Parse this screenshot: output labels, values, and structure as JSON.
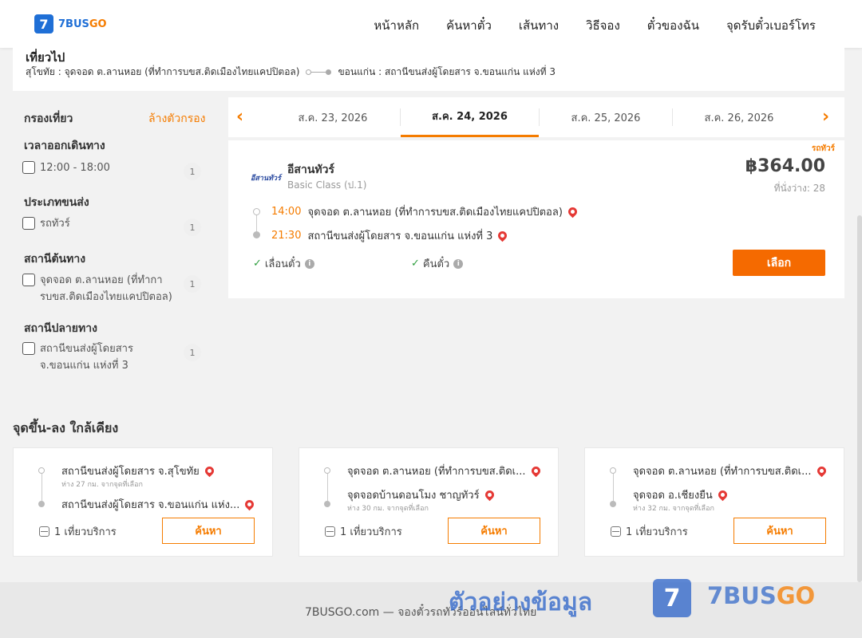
{
  "header": {
    "logo_mark": "7",
    "logo_text_a": "7BUS",
    "logo_text_b": "GO",
    "nav": [
      "หน้าหลัก",
      "ค้นหาตั๋ว",
      "เส้นทาง",
      "วิธีจอง",
      "ตั๋วของฉัน",
      "จุดรับตั๋วเบอร์โทร"
    ]
  },
  "trip": {
    "title": "เที่ยวไป",
    "from": "สุโขทัย : จุดจอด ต.ลานหอย (ที่ทำการบขส.ติดเมืองไทยแคปปิตอล)",
    "to": "ขอนแก่น : สถานีขนส่งผู้โดยสาร จ.ขอนแก่น แห่งที่ 3"
  },
  "filter": {
    "title": "กรองเที่ยว",
    "clear": "ล้างตัวกรอง",
    "sections": [
      {
        "label": "เวลาออกเดินทาง",
        "option": "12:00 - 18:00",
        "count": "1"
      },
      {
        "label": "ประเภทขนส่ง",
        "option": "รถทัวร์",
        "count": "1"
      },
      {
        "label": "สถานีต้นทาง",
        "option": "จุดจอด ต.ลานหอย (ที่ทำการบขส.ติดเมืองไทยแคปปิตอล)",
        "count": "1"
      },
      {
        "label": "สถานีปลายทาง",
        "option": "สถานีขนส่งผู้โดยสาร จ.ขอนแก่น แห่งที่ 3",
        "count": "1"
      }
    ]
  },
  "dates": {
    "prev": "‹",
    "next": "›",
    "tabs": [
      "ส.ค. 23, 2026",
      "ส.ค. 24, 2026",
      "ส.ค. 25, 2026",
      "ส.ค. 26, 2026"
    ],
    "active_index": 1
  },
  "result": {
    "tag": "รถทัวร์",
    "operator_logo": "อีสานทัวร์",
    "operator": "อีสานทัวร์",
    "class": "Basic Class (ป.1)",
    "price": "฿364.00",
    "seats": "ที่นั่งว่าง: 28",
    "depart_time": "14:00",
    "depart_stop": "จุดจอด ต.ลานหอย (ที่ทำการบขส.ติดเมืองไทยแคปปิตอล)",
    "arrive_time": "21:30",
    "arrive_stop": "สถานีขนส่งผู้โดยสาร จ.ขอนแก่น แห่งที่ 3",
    "feature1": "เลื่อนตั๋ว",
    "feature2": "คืนตั๋ว",
    "select": "เลือก"
  },
  "nearby": {
    "title": "จุดขึ้น-ลง ใกล้เคียง",
    "cards": [
      {
        "from": "สถานีขนส่งผู้โดยสาร จ.สุโขทัย",
        "distance": "ห่าง 27 กม. จากจุดที่เลือก",
        "to": "สถานีขนส่งผู้โดยสาร จ.ขอนแก่น แห่ง...",
        "trips": "1 เที่ยวบริการ",
        "button": "ค้นหา"
      },
      {
        "from": "จุดจอด ต.ลานหอย (ที่ทำการบขส.ติดเ...",
        "to": "จุดจอดบ้านดอนโมง ชาญทัวร์",
        "distance": "ห่าง 30 กม. จากจุดที่เลือก",
        "trips": "1 เที่ยวบริการ",
        "button": "ค้นหา"
      },
      {
        "from": "จุดจอด ต.ลานหอย (ที่ทำการบขส.ติดเ...",
        "to": "จุดจอด อ.เชียงยืน",
        "distance": "ห่าง 32 กม. จากจุดที่เลือก",
        "trips": "1 เที่ยวบริการ",
        "button": "ค้นหา"
      }
    ]
  },
  "footer": {
    "text": "7BUSGO.com — จองตั๋วรถทัวร์ออนไลน์ทั่วไทย"
  },
  "watermark": {
    "text": "ตัวอย่างข้อมูล",
    "mark": "7",
    "name_a": "7BUS",
    "name_b": "GO"
  },
  "colors": {
    "accent": "#f57c00",
    "brand": "#1f6fd6",
    "button": "#f56a00"
  }
}
